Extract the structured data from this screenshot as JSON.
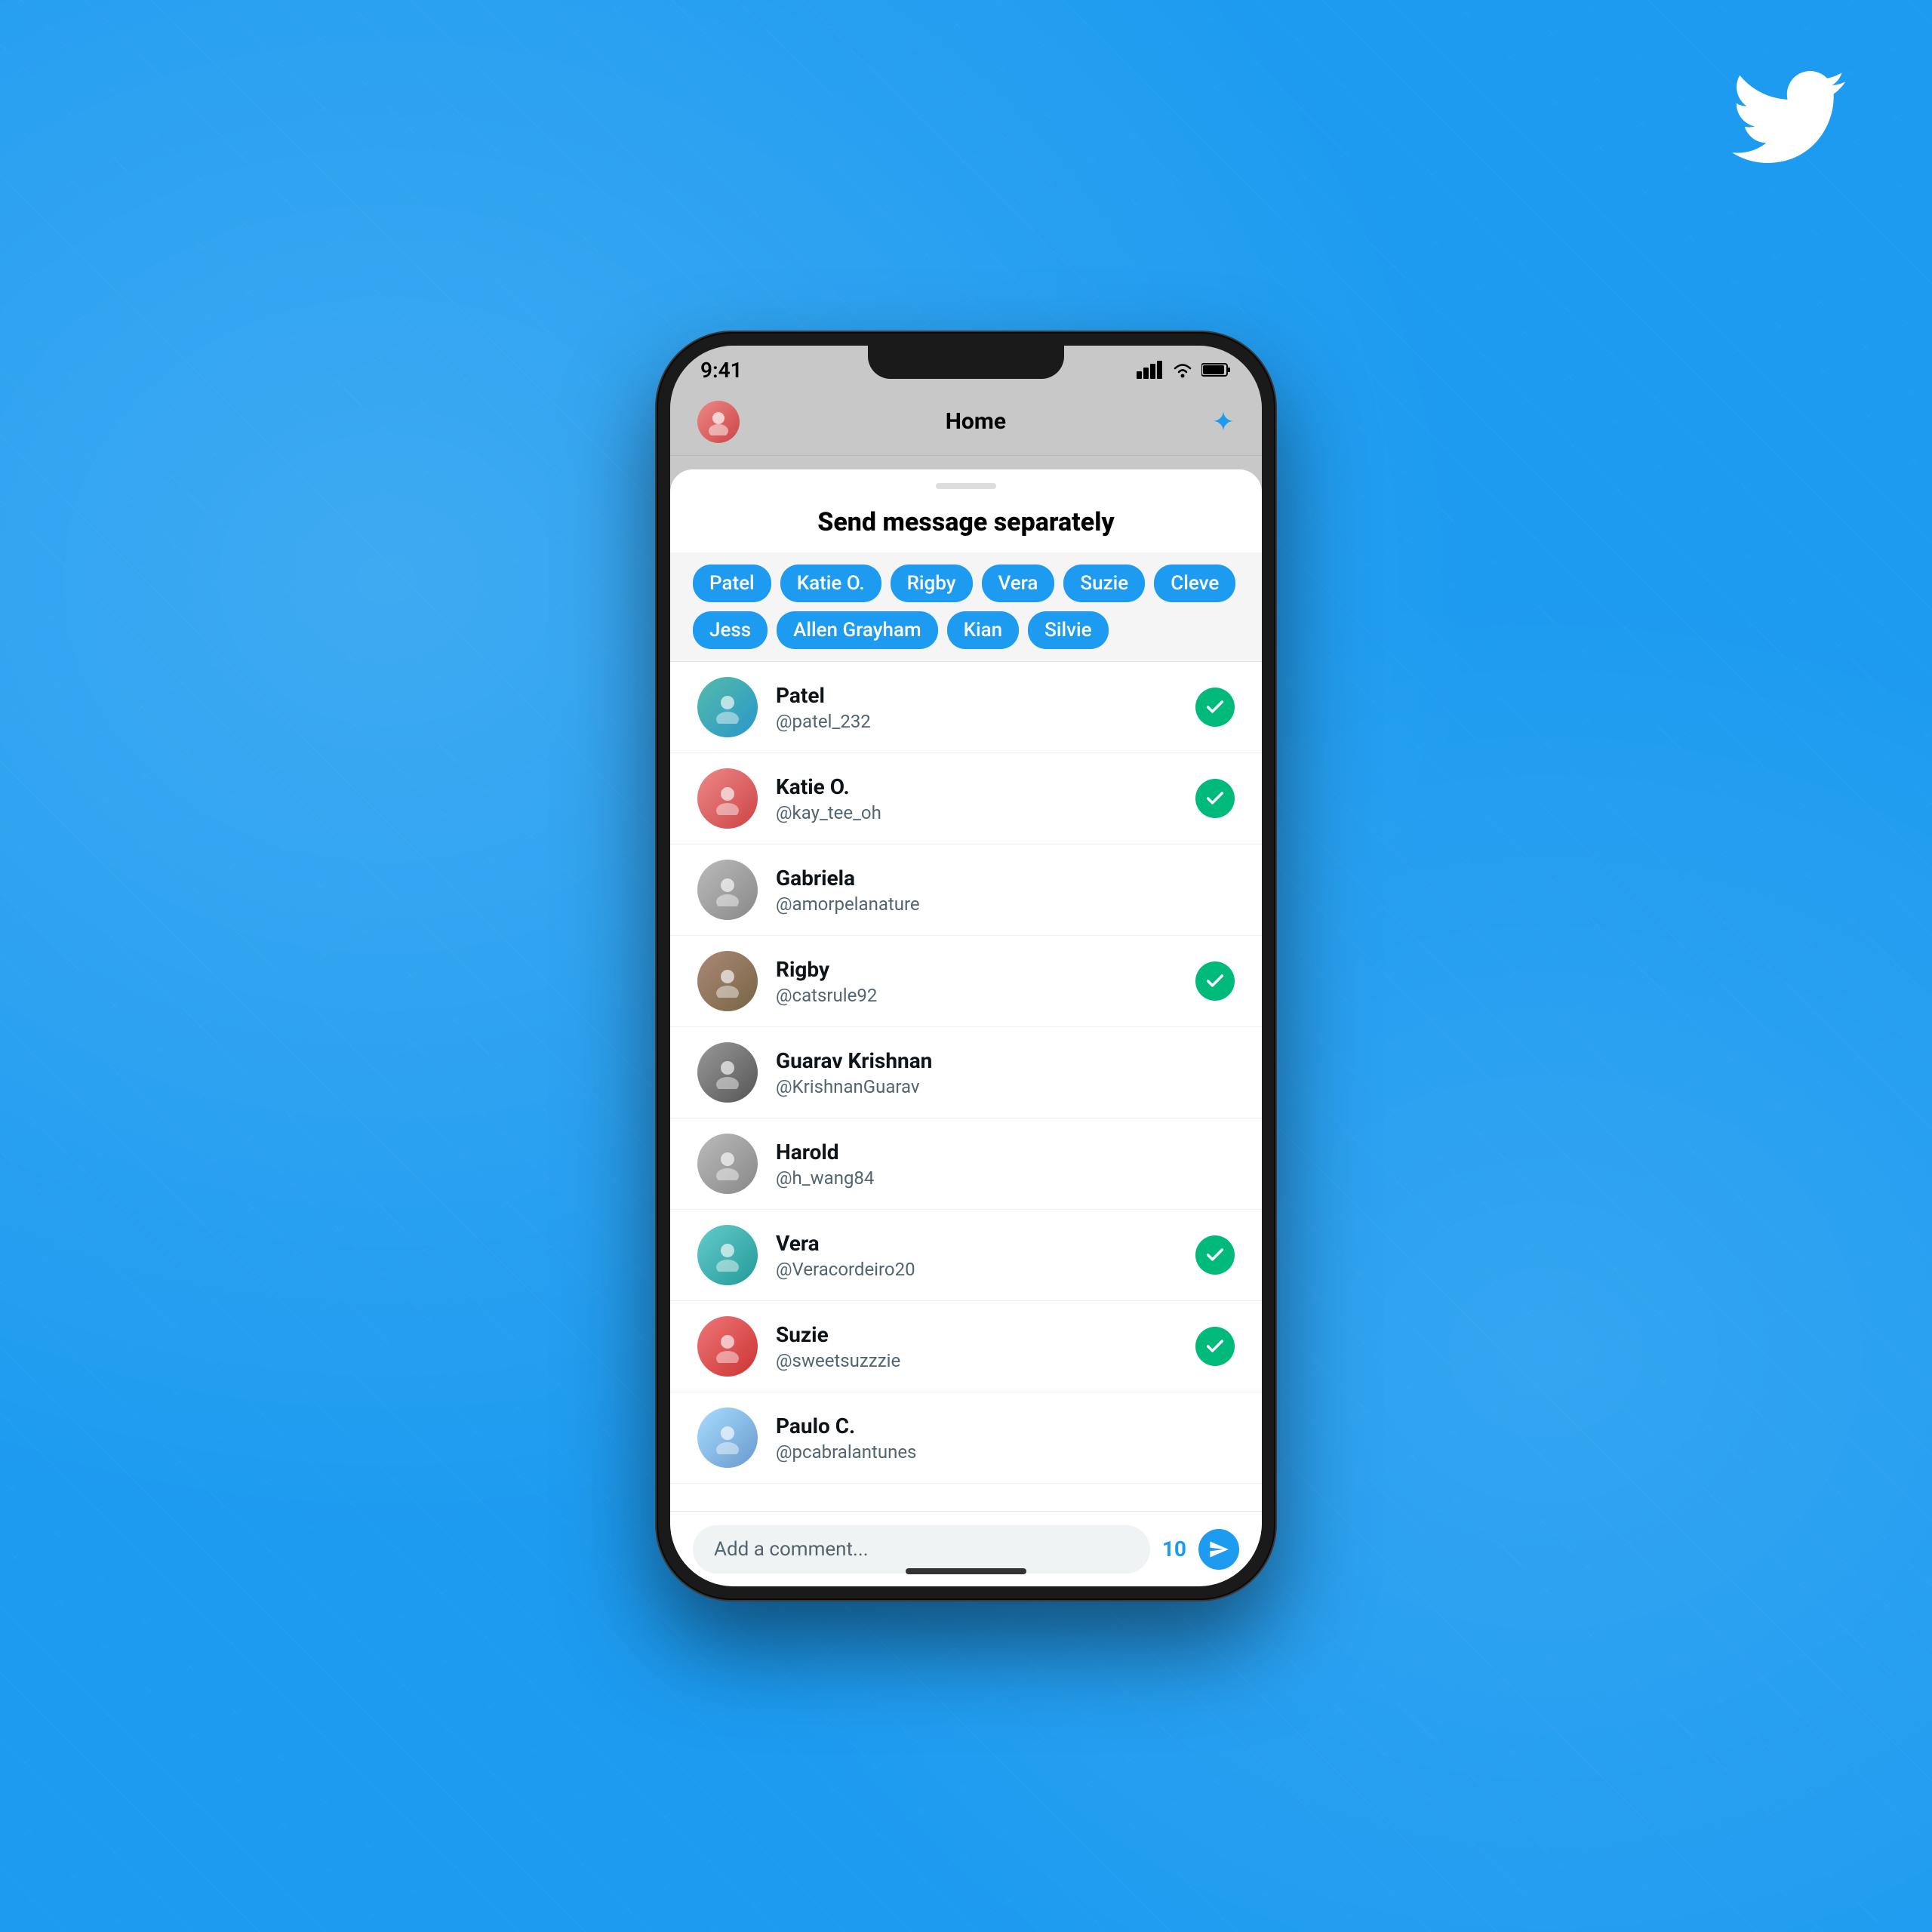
{
  "background": {
    "color": "#1d9bf0"
  },
  "twitter_logo": {
    "alt": "Twitter bird logo"
  },
  "status_bar": {
    "time": "9:41",
    "icons": [
      "signal",
      "wifi",
      "battery"
    ]
  },
  "app_header": {
    "title": "Home",
    "avatar_label": "User avatar",
    "sparkle_label": "✦"
  },
  "sheet": {
    "title": "Send message separately",
    "handle_label": "drag handle"
  },
  "tags": [
    "Patel",
    "Katie O.",
    "Rigby",
    "Vera",
    "Suzie",
    "Cleve",
    "Jess",
    "Allen Grayham",
    "Kian",
    "Silvie"
  ],
  "contacts": [
    {
      "name": "Patel",
      "handle": "@patel_232",
      "selected": true,
      "av_class": "av-blue"
    },
    {
      "name": "Katie O.",
      "handle": "@kay_tee_oh",
      "selected": true,
      "av_class": "av-pink"
    },
    {
      "name": "Gabriela",
      "handle": "@amorpelanature",
      "selected": false,
      "av_class": "av-gray"
    },
    {
      "name": "Rigby",
      "handle": "@catsrule92",
      "selected": true,
      "av_class": "av-brown"
    },
    {
      "name": "Guarav Krishnan",
      "handle": "@KrishnanGuarav",
      "selected": false,
      "av_class": "av-darkgray"
    },
    {
      "name": "Harold",
      "handle": "@h_wang84",
      "selected": false,
      "av_class": "av-gray"
    },
    {
      "name": "Vera",
      "handle": "@Veracordeiro20",
      "selected": true,
      "av_class": "av-teal"
    },
    {
      "name": "Suzie",
      "handle": "@sweetsuzzzie",
      "selected": true,
      "av_class": "av-red"
    },
    {
      "name": "Paulo C.",
      "handle": "@pcabralantunes",
      "selected": false,
      "av_class": "av-lightblue"
    }
  ],
  "comment_bar": {
    "placeholder": "Add a comment...",
    "count": "10",
    "send_label": "Send"
  }
}
